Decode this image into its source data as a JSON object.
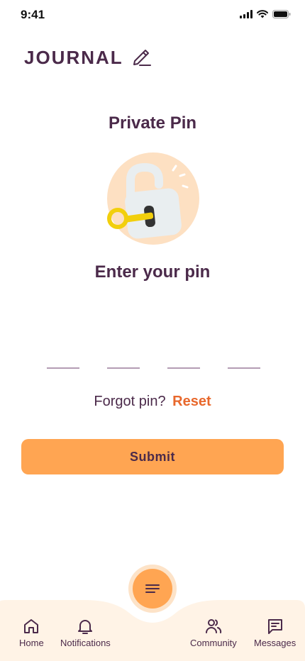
{
  "status_bar": {
    "time": "9:41"
  },
  "header": {
    "title": "JOURNAL"
  },
  "page": {
    "title": "Private Pin",
    "subtitle": "Enter your pin",
    "pin_digits": [
      "",
      "",
      "",
      ""
    ],
    "forgot_text": "Forgot pin?",
    "reset_label": "Reset",
    "submit_label": "Submit"
  },
  "nav": {
    "items": [
      {
        "label": "Home",
        "icon": "home-icon"
      },
      {
        "label": "Notifications",
        "icon": "bell-icon"
      },
      {
        "label": "Community",
        "icon": "users-icon"
      },
      {
        "label": "Messages",
        "icon": "message-icon"
      }
    ],
    "fab_icon": "menu-icon"
  },
  "colors": {
    "primary_text": "#4b2a4a",
    "accent": "#ffa552",
    "link": "#e8682c",
    "nav_bg": "#fff3e6"
  }
}
